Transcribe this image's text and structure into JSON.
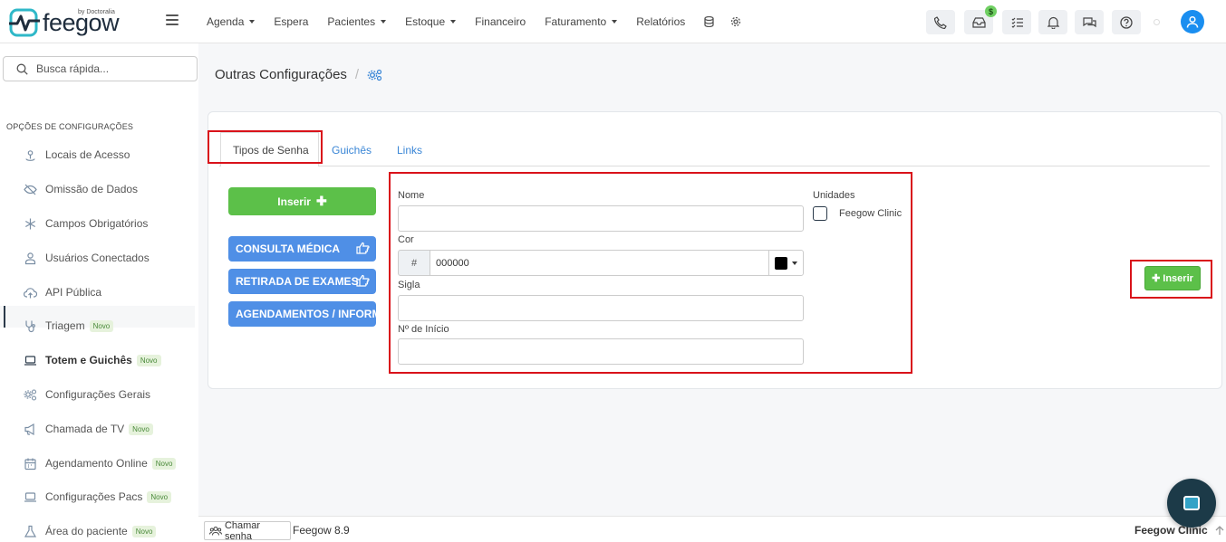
{
  "brand": {
    "name": "feegow",
    "sub": "by Doctoralia"
  },
  "nav": {
    "items": [
      {
        "label": "Agenda",
        "dropdown": true
      },
      {
        "label": "Espera",
        "dropdown": false
      },
      {
        "label": "Pacientes",
        "dropdown": true
      },
      {
        "label": "Estoque",
        "dropdown": true
      },
      {
        "label": "Financeiro",
        "dropdown": false
      },
      {
        "label": "Faturamento",
        "dropdown": true
      },
      {
        "label": "Relatórios",
        "dropdown": false
      }
    ],
    "badge": "$"
  },
  "sidebar": {
    "search_placeholder": "Busca rápida...",
    "heading": "OPÇÕES DE CONFIGURAÇÕES",
    "items": [
      {
        "label": "Locais de Acesso",
        "icon": "location-icon",
        "novo": false
      },
      {
        "label": "Omissão de Dados",
        "icon": "eye-off-icon",
        "novo": false
      },
      {
        "label": "Campos Obrigatórios",
        "icon": "asterisk-icon",
        "novo": false
      },
      {
        "label": "Usuários Conectados",
        "icon": "user-icon",
        "novo": false
      },
      {
        "label": "API Pública",
        "icon": "cloud-upload-icon",
        "novo": false
      },
      {
        "label": "Triagem",
        "icon": "stethoscope-icon",
        "novo": true
      },
      {
        "label": "Totem e Guichês",
        "icon": "laptop-icon",
        "novo": true,
        "active": true
      },
      {
        "label": "Configurações Gerais",
        "icon": "cogs-icon",
        "novo": false
      },
      {
        "label": "Chamada de TV",
        "icon": "megaphone-icon",
        "novo": true
      },
      {
        "label": "Agendamento Online",
        "icon": "calendar-icon",
        "novo": true
      },
      {
        "label": "Configurações Pacs",
        "icon": "laptop-icon",
        "novo": true
      },
      {
        "label": "Área do paciente",
        "icon": "flask-icon",
        "novo": true
      }
    ],
    "novo_label": "Novo"
  },
  "page": {
    "title": "Outras Configurações",
    "tabs": [
      "Tipos de Senha",
      "Guichês",
      "Links"
    ],
    "insert_button": "Inserir",
    "password_types": [
      "CONSULTA MÉDICA",
      "RETIRADA DE EXAMES",
      "AGENDAMENTOS / INFORMAÇÕES"
    ],
    "form": {
      "nome_label": "Nome",
      "nome_value": "",
      "cor_label": "Cor",
      "cor_prefix": "#",
      "cor_value": "000000",
      "cor_swatch": "#000000",
      "sigla_label": "Sigla",
      "sigla_value": "",
      "inicio_label": "Nº de Início",
      "inicio_value": "",
      "unidades_label": "Unidades",
      "unidade_option": "Feegow Clinic"
    },
    "insert_right_button": "Inserir"
  },
  "footer": {
    "chamar_label": "Chamar senha",
    "version": "Feegow 8.9",
    "clinic": "Feegow Clinic"
  },
  "colors": {
    "accent_blue": "#4f8fe6",
    "green": "#5cc049",
    "highlight_red": "#d9121a",
    "avatar": "#1a8ef0"
  }
}
